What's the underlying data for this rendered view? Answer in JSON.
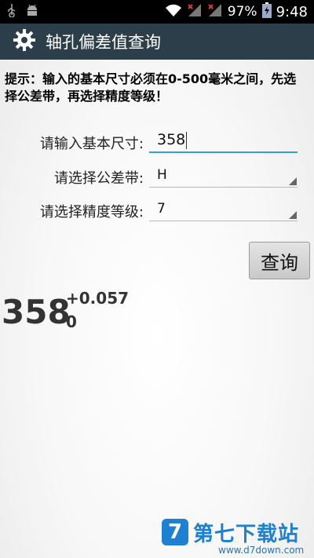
{
  "status_bar": {
    "battery": "97%",
    "time": "9:48"
  },
  "app": {
    "title": "轴孔偏差值查询"
  },
  "hint": "提示：输入的基本尺寸必须在0-500毫米之间，先选择公差带，再选择精度等级！",
  "form": {
    "basic_size_label": "请输入基本尺寸:",
    "basic_size_value": "358",
    "tolerance_label": "请选择公差带:",
    "tolerance_value": "H",
    "grade_label": "请选择精度等级:",
    "grade_value": "7"
  },
  "query_button": "查询",
  "result": {
    "base": "358",
    "upper_deviation": "+0.057",
    "lower_deviation": "0"
  },
  "watermark": {
    "brand": "第七下载站",
    "domain": "www.d7down.com"
  },
  "colors": {
    "action_bar": "#2c3e4a",
    "input_underline": "#3a9bd9",
    "watermark_blue": "#1f7fd0"
  }
}
